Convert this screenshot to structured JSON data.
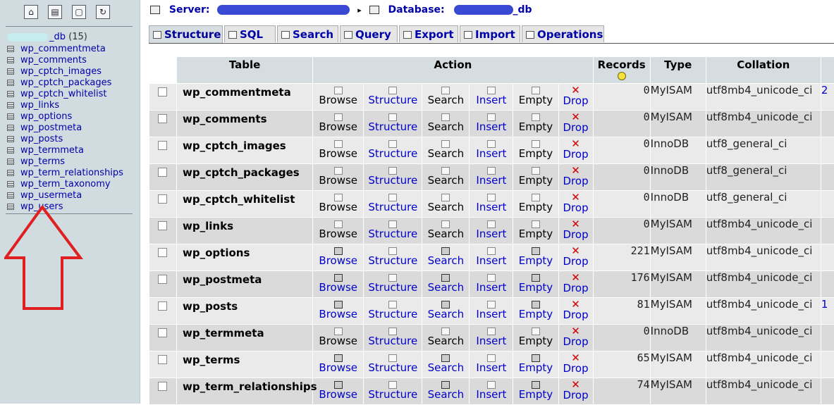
{
  "sidebar": {
    "icons": [
      "home-icon",
      "sql-icon",
      "query-window-icon",
      "reload-icon"
    ],
    "database": {
      "name_suffix": "_db",
      "count": "(15)"
    },
    "tables": [
      "wp_commentmeta",
      "wp_comments",
      "wp_cptch_images",
      "wp_cptch_packages",
      "wp_cptch_whitelist",
      "wp_links",
      "wp_options",
      "wp_postmeta",
      "wp_posts",
      "wp_termmeta",
      "wp_terms",
      "wp_term_relationships",
      "wp_term_taxonomy",
      "wp_usermeta",
      "wp_users"
    ]
  },
  "header": {
    "server_label": "Server:",
    "separator": "▸",
    "database_label": "Database:",
    "database_suffix": "_db"
  },
  "tabs": [
    "Structure",
    "SQL",
    "Search",
    "Query",
    "Export",
    "Import",
    "Operations"
  ],
  "table": {
    "headers": {
      "table": "Table",
      "action": "Action",
      "records": "Records",
      "type": "Type",
      "collation": "Collation"
    },
    "action_labels": [
      "Browse",
      "Structure",
      "Search",
      "Insert",
      "Empty",
      "Drop"
    ],
    "rows": [
      {
        "name": "wp_commentmeta",
        "records": "0",
        "type": "MyISAM",
        "collation": "utf8mb4_unicode_ci",
        "extra": "2",
        "has_data": false
      },
      {
        "name": "wp_comments",
        "records": "0",
        "type": "MyISAM",
        "collation": "utf8mb4_unicode_ci",
        "extra": "",
        "has_data": false
      },
      {
        "name": "wp_cptch_images",
        "records": "0",
        "type": "InnoDB",
        "collation": "utf8_general_ci",
        "extra": "",
        "has_data": false
      },
      {
        "name": "wp_cptch_packages",
        "records": "0",
        "type": "InnoDB",
        "collation": "utf8_general_ci",
        "extra": "",
        "has_data": false
      },
      {
        "name": "wp_cptch_whitelist",
        "records": "0",
        "type": "InnoDB",
        "collation": "utf8_general_ci",
        "extra": "",
        "has_data": false
      },
      {
        "name": "wp_links",
        "records": "0",
        "type": "MyISAM",
        "collation": "utf8mb4_unicode_ci",
        "extra": "",
        "has_data": false
      },
      {
        "name": "wp_options",
        "records": "221",
        "type": "MyISAM",
        "collation": "utf8mb4_unicode_ci",
        "extra": "",
        "has_data": true
      },
      {
        "name": "wp_postmeta",
        "records": "176",
        "type": "MyISAM",
        "collation": "utf8mb4_unicode_ci",
        "extra": "",
        "has_data": true
      },
      {
        "name": "wp_posts",
        "records": "81",
        "type": "MyISAM",
        "collation": "utf8mb4_unicode_ci",
        "extra": "1",
        "has_data": true
      },
      {
        "name": "wp_termmeta",
        "records": "0",
        "type": "InnoDB",
        "collation": "utf8mb4_unicode_ci",
        "extra": "",
        "has_data": false
      },
      {
        "name": "wp_terms",
        "records": "65",
        "type": "MyISAM",
        "collation": "utf8mb4_unicode_ci",
        "extra": "",
        "has_data": true
      },
      {
        "name": "wp_term_relationships",
        "records": "74",
        "type": "MyISAM",
        "collation": "utf8mb4_unicode_ci",
        "extra": "",
        "has_data": true
      }
    ]
  }
}
